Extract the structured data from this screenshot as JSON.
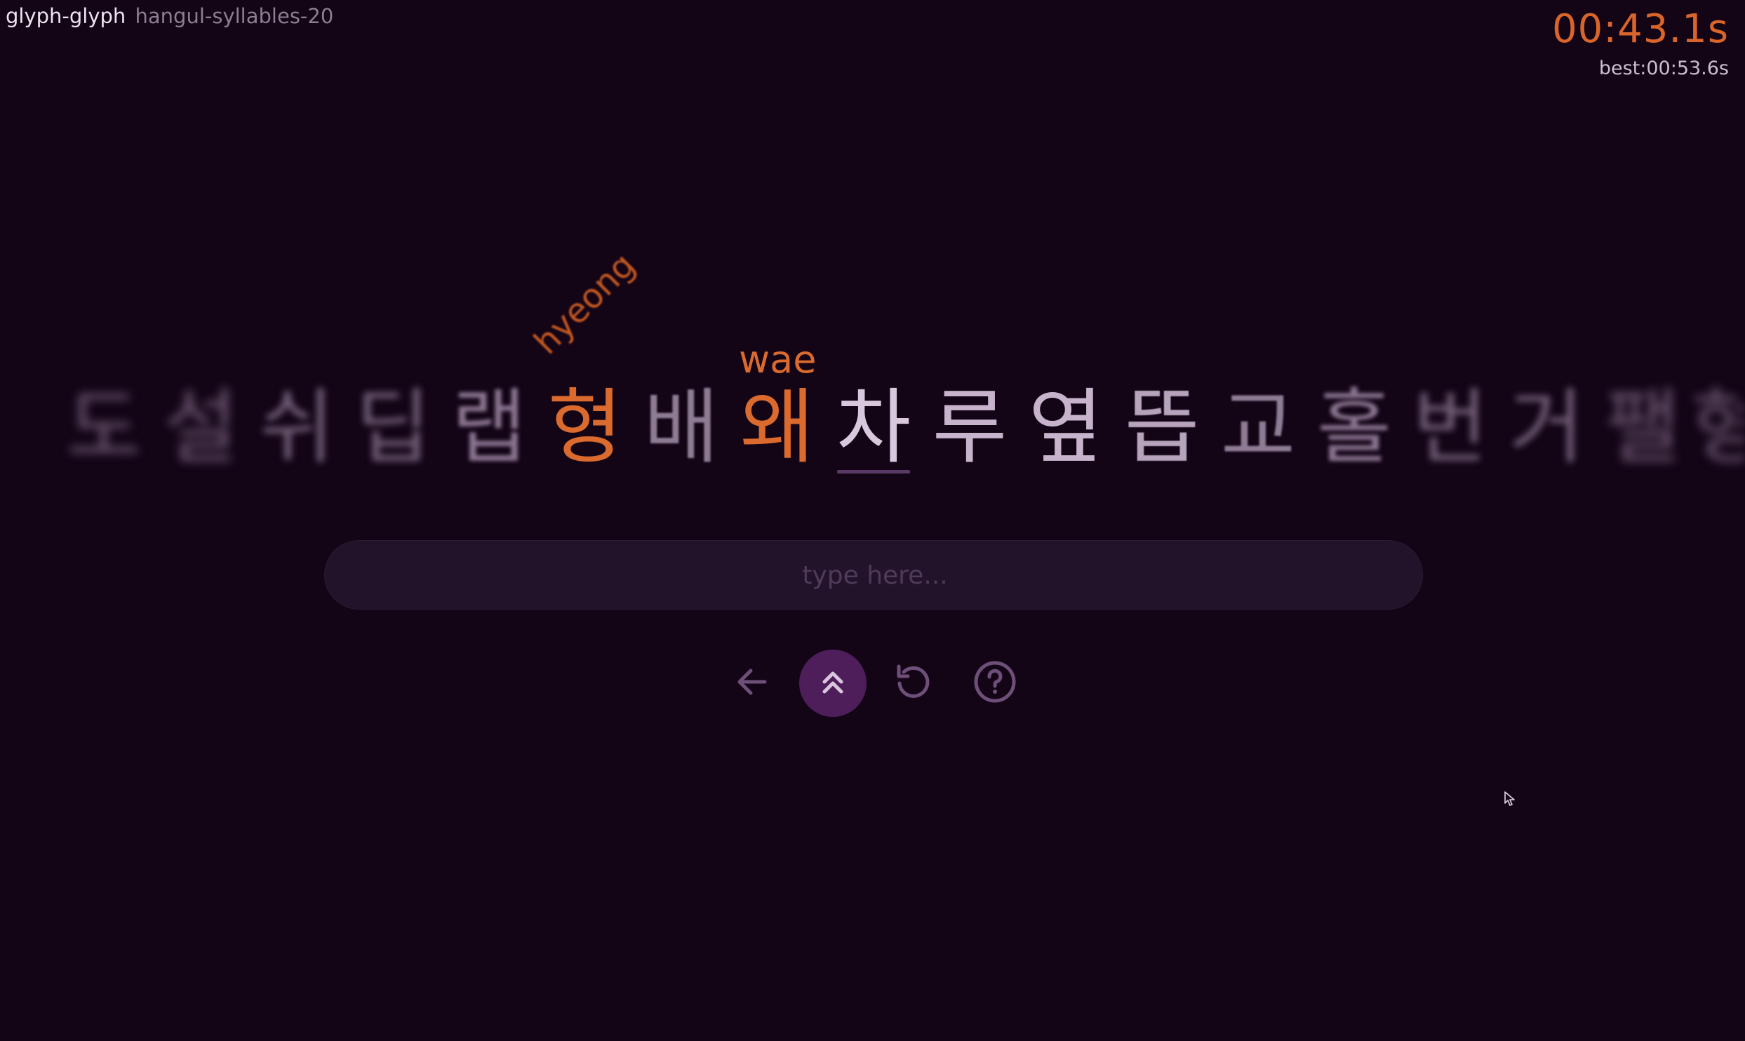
{
  "header": {
    "app_name": "glyph-glyph",
    "mode": "hangul-syllables-20"
  },
  "timer": {
    "elapsed": "00:43.1s",
    "best": "best:00:53.6s"
  },
  "strip": {
    "glyphs": [
      "도",
      "설",
      "쉬",
      "딥",
      "랩",
      "형",
      "배",
      "왜",
      "차",
      "루",
      "옆",
      "뜹",
      "교",
      "홀",
      "번",
      "거",
      "팰",
      "형"
    ],
    "romaji_above": {
      "hyeong": "hyeong",
      "wae": "wae"
    }
  },
  "input": {
    "placeholder": "type here...",
    "value": ""
  },
  "controls": {
    "back_icon": "arrow-left-icon",
    "skip_icon": "double-chevron-up-icon",
    "restart_icon": "restart-icon",
    "help_icon": "help-circle-icon"
  },
  "colors": {
    "background": "#130416",
    "accent_orange": "#da6a2d",
    "active_button": "#4e1e5a",
    "input_bg": "#22132a"
  }
}
